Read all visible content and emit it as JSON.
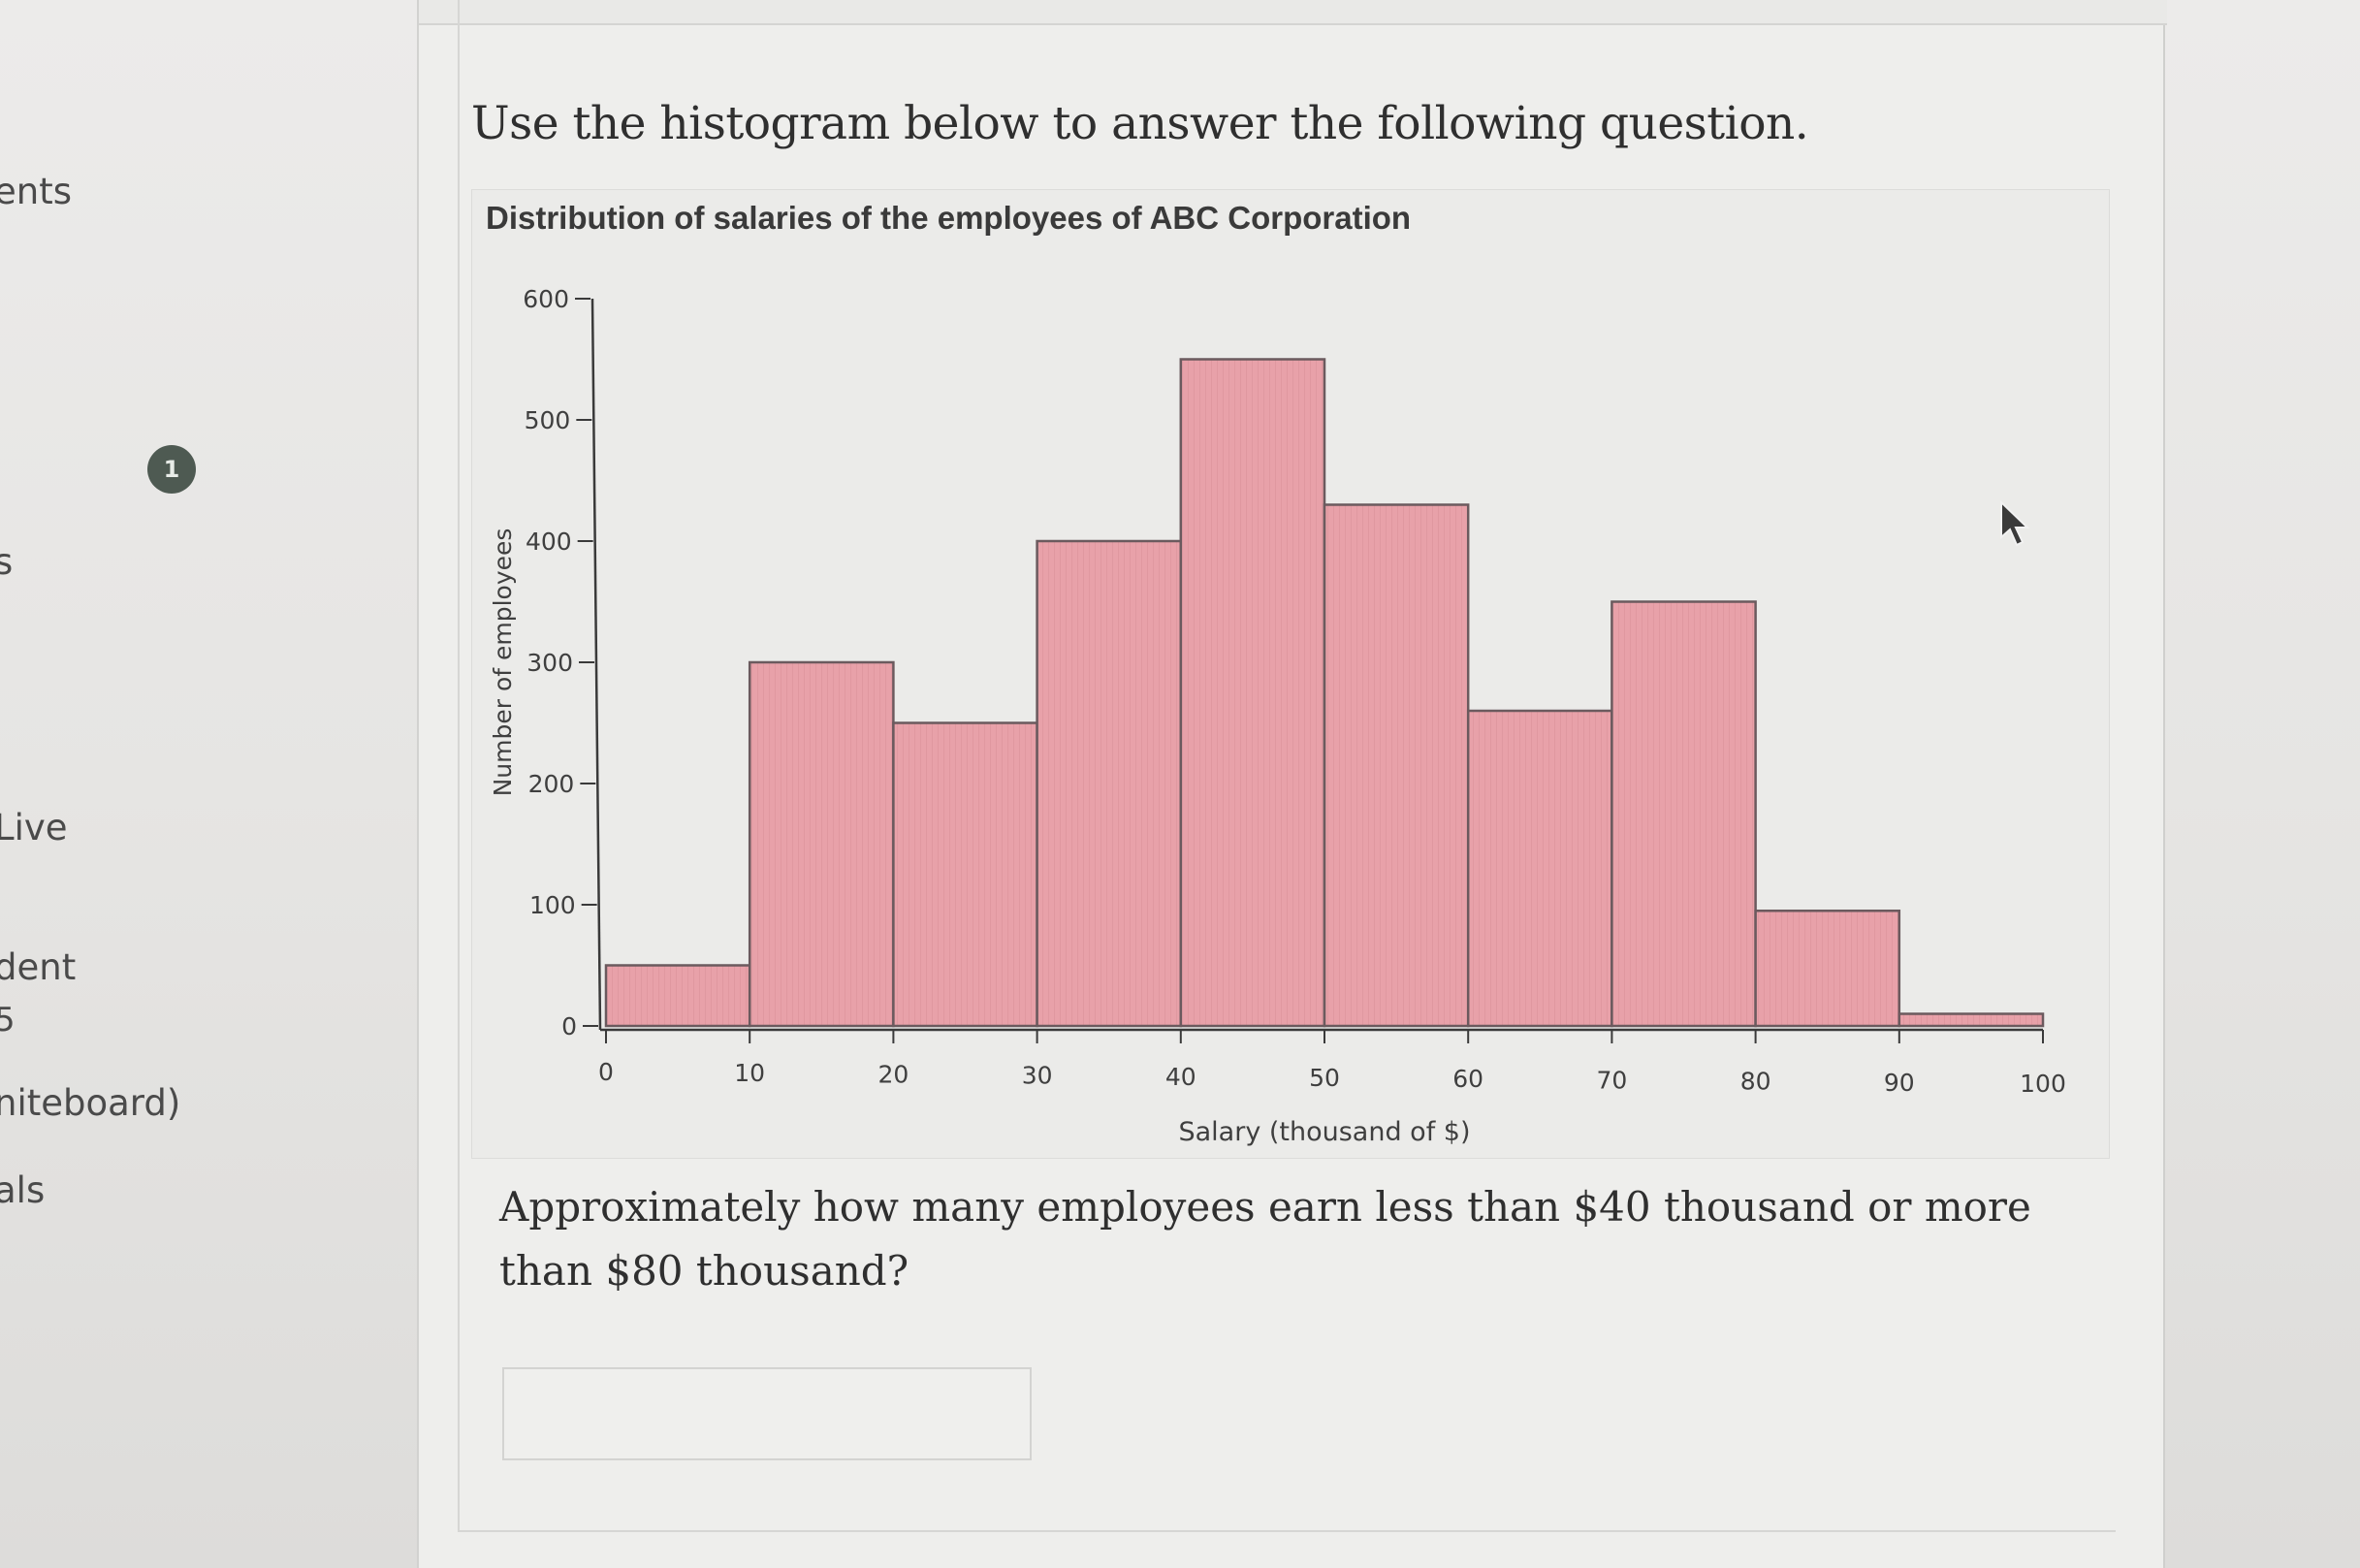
{
  "sidebar": {
    "items": [
      {
        "label": "ents"
      },
      {
        "label": "s"
      },
      {
        "label": "Live"
      },
      {
        "label": "dent"
      },
      {
        "label": "5"
      },
      {
        "label": "niteboard)"
      },
      {
        "label": "als"
      }
    ],
    "badge": "1"
  },
  "instruction": "Use the histogram below to answer the following question.",
  "chart_data": {
    "type": "bar",
    "title": "Distribution of salaries of the employees of ABC Corporation",
    "xlabel": "Salary (thousand of $)",
    "ylabel": "Number of employees",
    "bin_edges": [
      0,
      10,
      20,
      30,
      40,
      50,
      60,
      70,
      80,
      90,
      100
    ],
    "values": [
      50,
      300,
      250,
      400,
      550,
      430,
      260,
      350,
      95,
      10
    ],
    "x_ticks": [
      "0",
      "10",
      "20",
      "30",
      "40",
      "50",
      "60",
      "70",
      "80",
      "90",
      "100"
    ],
    "y_ticks": [
      "0",
      "100",
      "200",
      "300",
      "400",
      "500",
      "600"
    ],
    "ylim": [
      0,
      600
    ],
    "xlim": [
      0,
      100
    ],
    "bar_color": "#e8a0a8",
    "edge_color": "#6b5a5e",
    "grid": false
  },
  "question": {
    "text": "Approximately how many employees earn less than $40 thousand or more than $80 thousand?"
  },
  "answer": {
    "value": "",
    "placeholder": ""
  }
}
